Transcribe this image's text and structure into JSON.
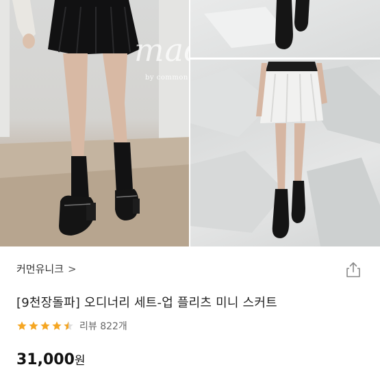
{
  "gallery": {
    "watermark": "made",
    "watermark_sub": "by common unique"
  },
  "product": {
    "brand": "커먼유니크",
    "brand_chevron": ">",
    "title": "[9천장돌파] 오디너리 세트-업 플리츠 미니 스커트",
    "rating": 4.5,
    "review_label": "리뷰 822개",
    "price": "31,000",
    "price_unit": "원"
  },
  "colors": {
    "star": "#F5A623",
    "star_empty": "#DDDDDD",
    "text": "#222222",
    "muted": "#666666"
  },
  "icons": {
    "share": "share-icon",
    "star": "star-icon"
  }
}
